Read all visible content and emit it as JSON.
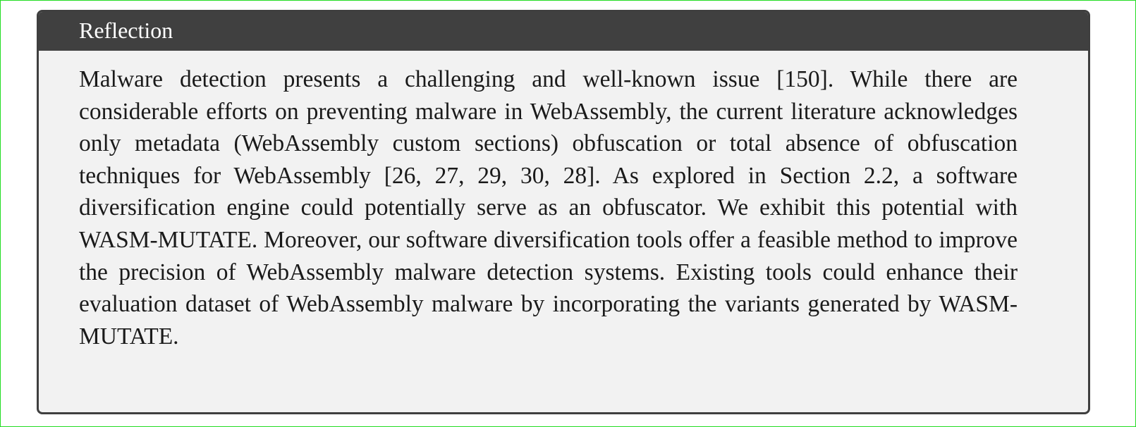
{
  "box": {
    "title": "Reflection",
    "paragraph": "Malware detection presents a challenging and well-known issue [150]. While there are considerable efforts on preventing malware in WebAssembly, the current literature acknowledges only metadata (WebAssembly custom sections) obfuscation or total absence of obfuscation techniques for WebAssembly [26, 27, 29, 30, 28]. As explored in Section 2.2, a software diversification engine could potentially serve as an obfuscator. We exhibit this potential with WASM-MUTATE. Moreover, our software diversification tools offer a feasible method to improve the precision of WebAssembly malware detection systems. Existing tools could enhance their evaluation dataset of WebAssembly malware by incorporating the variants generated by WASM-MUTATE."
  },
  "colors": {
    "header_background": "#404040",
    "header_text": "#ffffff",
    "body_background": "#f2f2f2",
    "border": "#3f3f3f",
    "page_frame": "#22dd22"
  }
}
